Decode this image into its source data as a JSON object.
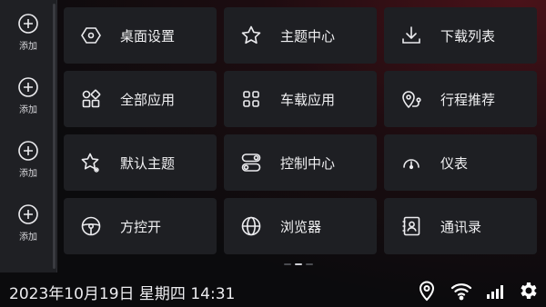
{
  "sidebar": {
    "items": [
      {
        "label": "添加",
        "icon": "add-circle-icon"
      },
      {
        "label": "添加",
        "icon": "add-circle-icon"
      },
      {
        "label": "添加",
        "icon": "add-circle-icon"
      },
      {
        "label": "添加",
        "icon": "add-circle-icon"
      }
    ]
  },
  "tiles": [
    {
      "label": "桌面设置",
      "icon": "hexagon-settings-icon"
    },
    {
      "label": "主题中心",
      "icon": "star-icon"
    },
    {
      "label": "下载列表",
      "icon": "download-icon"
    },
    {
      "label": "全部应用",
      "icon": "apps-grid-icon"
    },
    {
      "label": "车载应用",
      "icon": "car-apps-icon"
    },
    {
      "label": "行程推荐",
      "icon": "route-pin-icon"
    },
    {
      "label": "默认主题",
      "icon": "star-sparkle-icon"
    },
    {
      "label": "控制中心",
      "icon": "toggles-icon"
    },
    {
      "label": "仪表",
      "icon": "gauge-icon"
    },
    {
      "label": "方控开",
      "icon": "steering-wheel-icon"
    },
    {
      "label": "浏览器",
      "icon": "globe-icon"
    },
    {
      "label": "通讯录",
      "icon": "contacts-icon"
    }
  ],
  "pager": {
    "pages": 3,
    "active": 2
  },
  "status": {
    "datetime": "2023年10月19日 星期四 14:31",
    "icons": [
      "location-icon",
      "wifi-icon",
      "signal-icon",
      "settings-gear-icon"
    ]
  },
  "colors": {
    "tile_bg": "#1e1f23",
    "sidebar_bg": "#1f2024",
    "accent_glow": "#4a1219"
  }
}
